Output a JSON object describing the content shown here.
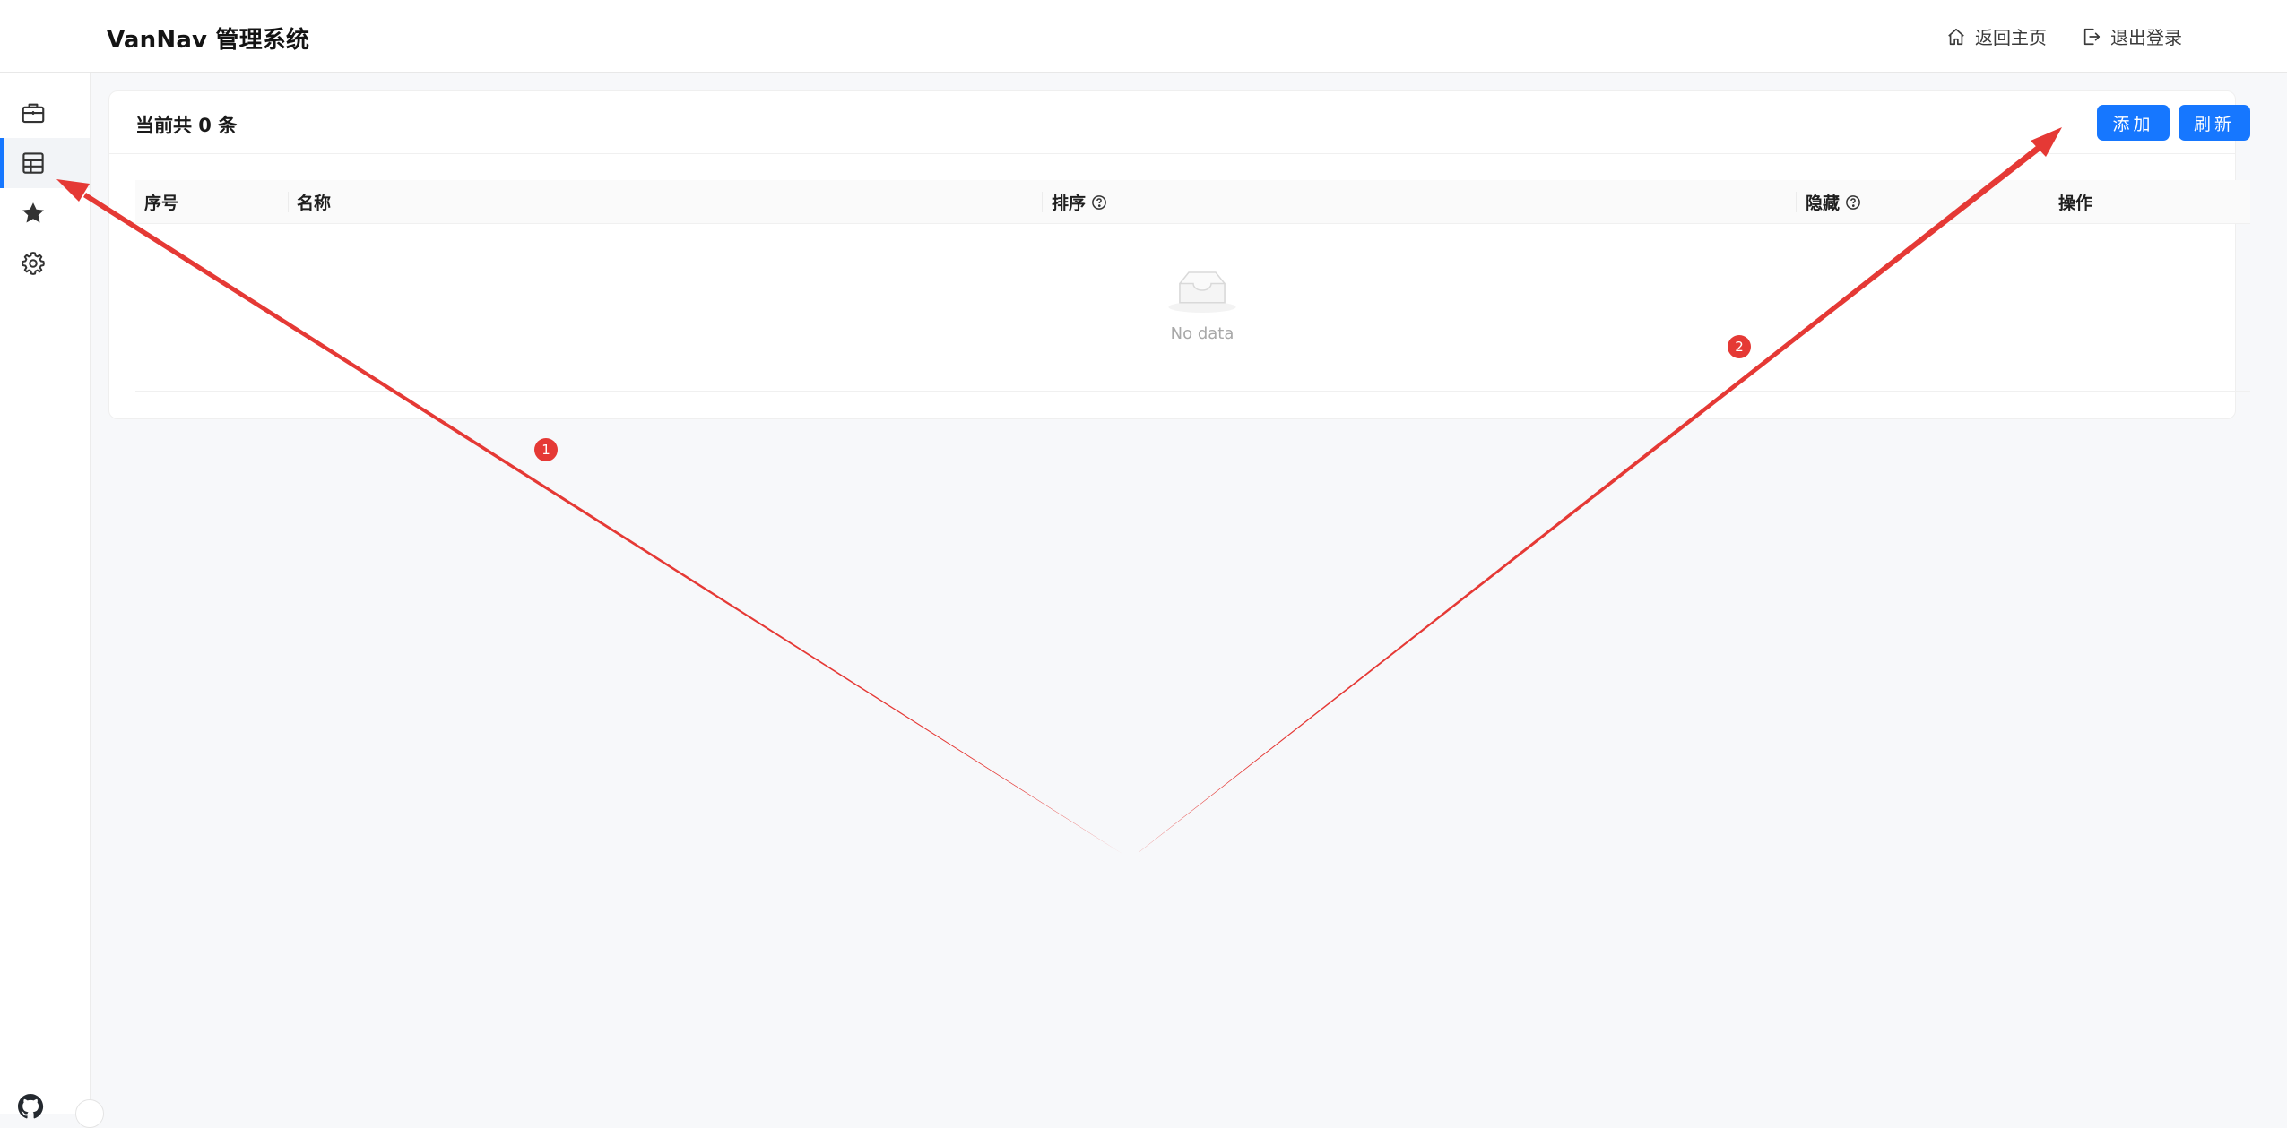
{
  "header": {
    "title": "VanNav 管理系统",
    "home_label": "返回主页",
    "logout_label": "退出登录"
  },
  "sidebar": {
    "items": [
      {
        "icon": "briefcase-icon",
        "active": false
      },
      {
        "icon": "table-icon",
        "active": true
      },
      {
        "icon": "star-icon",
        "active": false
      },
      {
        "icon": "gear-icon",
        "active": false
      }
    ],
    "footer_icon": "github-icon"
  },
  "card": {
    "count_text": "当前共 0 条",
    "add_label": "添加",
    "refresh_label": "刷新"
  },
  "table": {
    "columns": [
      {
        "label": "序号",
        "help": false
      },
      {
        "label": "名称",
        "help": false
      },
      {
        "label": "排序",
        "help": true
      },
      {
        "label": "隐藏",
        "help": true
      },
      {
        "label": "操作",
        "help": false
      }
    ],
    "empty_text": "No data"
  },
  "annotations": {
    "badges": [
      "1",
      "2"
    ],
    "color": "#e53935"
  },
  "colors": {
    "primary": "#1677ff",
    "annotation": "#e53935"
  }
}
